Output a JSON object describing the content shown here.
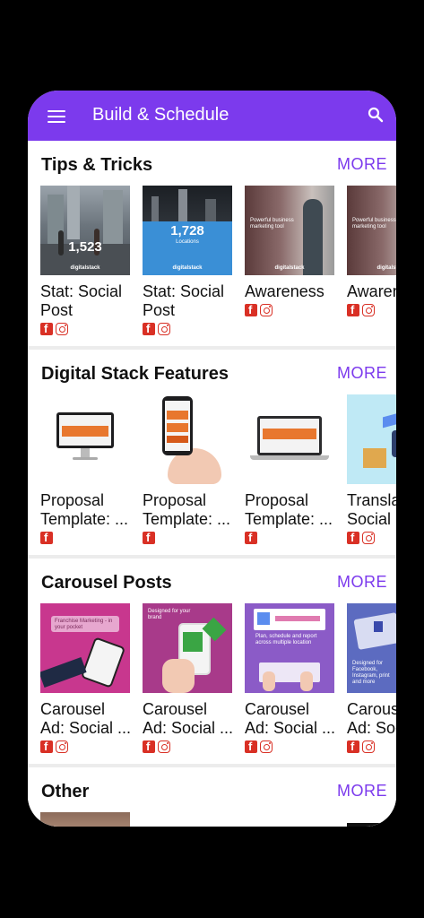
{
  "app": {
    "title": "Build & Schedule"
  },
  "colors": {
    "primary": "#7c3aed",
    "social_icons": "#d93025"
  },
  "icons": {
    "menu": "hamburger-menu-icon",
    "search": "search-icon",
    "facebook": "facebook-icon",
    "instagram": "instagram-icon"
  },
  "sections": [
    {
      "title": "Tips & Tricks",
      "more": "MORE",
      "cards": [
        {
          "line1": "Stat: Social",
          "line2": "Post",
          "thumb_number": "1,523",
          "thumb_brand": "digitalstack",
          "networks": [
            "facebook",
            "instagram"
          ]
        },
        {
          "line1": "Stat: Social",
          "line2": "Post",
          "thumb_number": "1,728",
          "thumb_label": "Locations",
          "thumb_brand": "digitalstack",
          "networks": [
            "facebook",
            "instagram"
          ]
        },
        {
          "line1": "Awareness",
          "line2": "",
          "thumb_text": "Powerful business marketing tool",
          "thumb_brand": "digitalstack",
          "networks": [
            "facebook",
            "instagram"
          ]
        },
        {
          "line1": "Awareness",
          "line2": "",
          "thumb_text": "Powerful business marketing tool",
          "thumb_brand": "digitalstack",
          "networks": [
            "facebook",
            "instagram"
          ]
        }
      ]
    },
    {
      "title": "Digital Stack Features",
      "more": "MORE",
      "cards": [
        {
          "line1": "Proposal",
          "line2": "Template: ...",
          "networks": [
            "facebook"
          ]
        },
        {
          "line1": "Proposal",
          "line2": "Template: ...",
          "networks": [
            "facebook"
          ]
        },
        {
          "line1": "Proposal",
          "line2": "Template: ...",
          "networks": [
            "facebook"
          ]
        },
        {
          "line1": "Translations",
          "line2": "Social",
          "networks": [
            "facebook",
            "instagram"
          ]
        }
      ]
    },
    {
      "title": "Carousel Posts",
      "more": "MORE",
      "cards": [
        {
          "line1": "Carousel",
          "line2": "Ad: Social ...",
          "thumb_text": "Franchise Marketing - in your pocket",
          "networks": [
            "facebook",
            "instagram"
          ]
        },
        {
          "line1": "Carousel",
          "line2": "Ad: Social ...",
          "thumb_text": "Designed for your brand",
          "networks": [
            "facebook",
            "instagram"
          ]
        },
        {
          "line1": "Carousel",
          "line2": "Ad: Social ...",
          "thumb_text": "Plan, schedule and report across multiple location",
          "networks": [
            "facebook",
            "instagram"
          ]
        },
        {
          "line1": "Carousel",
          "line2": "Ad: Social ...",
          "thumb_text": "Designed for Facebook, Instagram, print and more",
          "networks": [
            "facebook",
            "instagram"
          ]
        }
      ]
    },
    {
      "title": "Other",
      "more": "MORE",
      "cards": []
    }
  ]
}
